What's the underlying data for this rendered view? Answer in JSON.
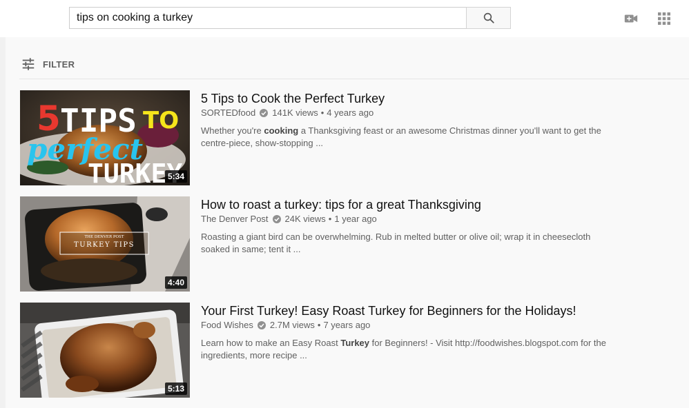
{
  "search": {
    "query": "tips on cooking a turkey"
  },
  "icons": {
    "search": "search-icon",
    "create": "video-camera-plus-icon",
    "apps": "apps-grid-icon",
    "filter": "filter-sliders-icon",
    "verified": "verified-check-icon"
  },
  "filter": {
    "label": "FILTER"
  },
  "results": [
    {
      "title": "5 Tips to Cook the Perfect Turkey",
      "channel": "SORTEDfood",
      "views": "141K views",
      "age": "4 years ago",
      "duration": "5:34",
      "desc_pre": "Whether you're ",
      "desc_bold": "cooking",
      "desc_post": " a Thanksgiving feast or an awesome Christmas dinner you'll want to get the centre-piece, show-stopping ...",
      "thumb_text": {
        "t1": "5",
        "t2": "TIPS",
        "t3": "TO",
        "t4": "perfect",
        "t5": "TURKEY"
      }
    },
    {
      "title": "How to roast a turkey: tips for a great Thanksgiving",
      "channel": "The Denver Post",
      "views": "24K views",
      "age": "1 year ago",
      "duration": "4:40",
      "desc_pre": "Roasting a giant bird can be overwhelming. Rub in melted butter or olive oil; wrap it in cheesecloth soaked in same; tent it ...",
      "desc_bold": "",
      "desc_post": "",
      "thumb_text": {
        "t1": "THE DENVER POST",
        "t2": "TURKEY TIPS"
      }
    },
    {
      "title": "Your First Turkey! Easy Roast Turkey for Beginners for the Holidays!",
      "channel": "Food Wishes",
      "views": "2.7M views",
      "age": "7 years ago",
      "duration": "5:13",
      "desc_pre": "Learn how to make an Easy Roast ",
      "desc_bold": "Turkey",
      "desc_post": " for Beginners! - Visit http://foodwishes.blogspot.com for the ingredients, more recipe ..."
    }
  ],
  "colors": {
    "accent_yellow": "#f5e51b",
    "accent_cyan": "#29c4ee",
    "accent_red": "#e8382f"
  }
}
